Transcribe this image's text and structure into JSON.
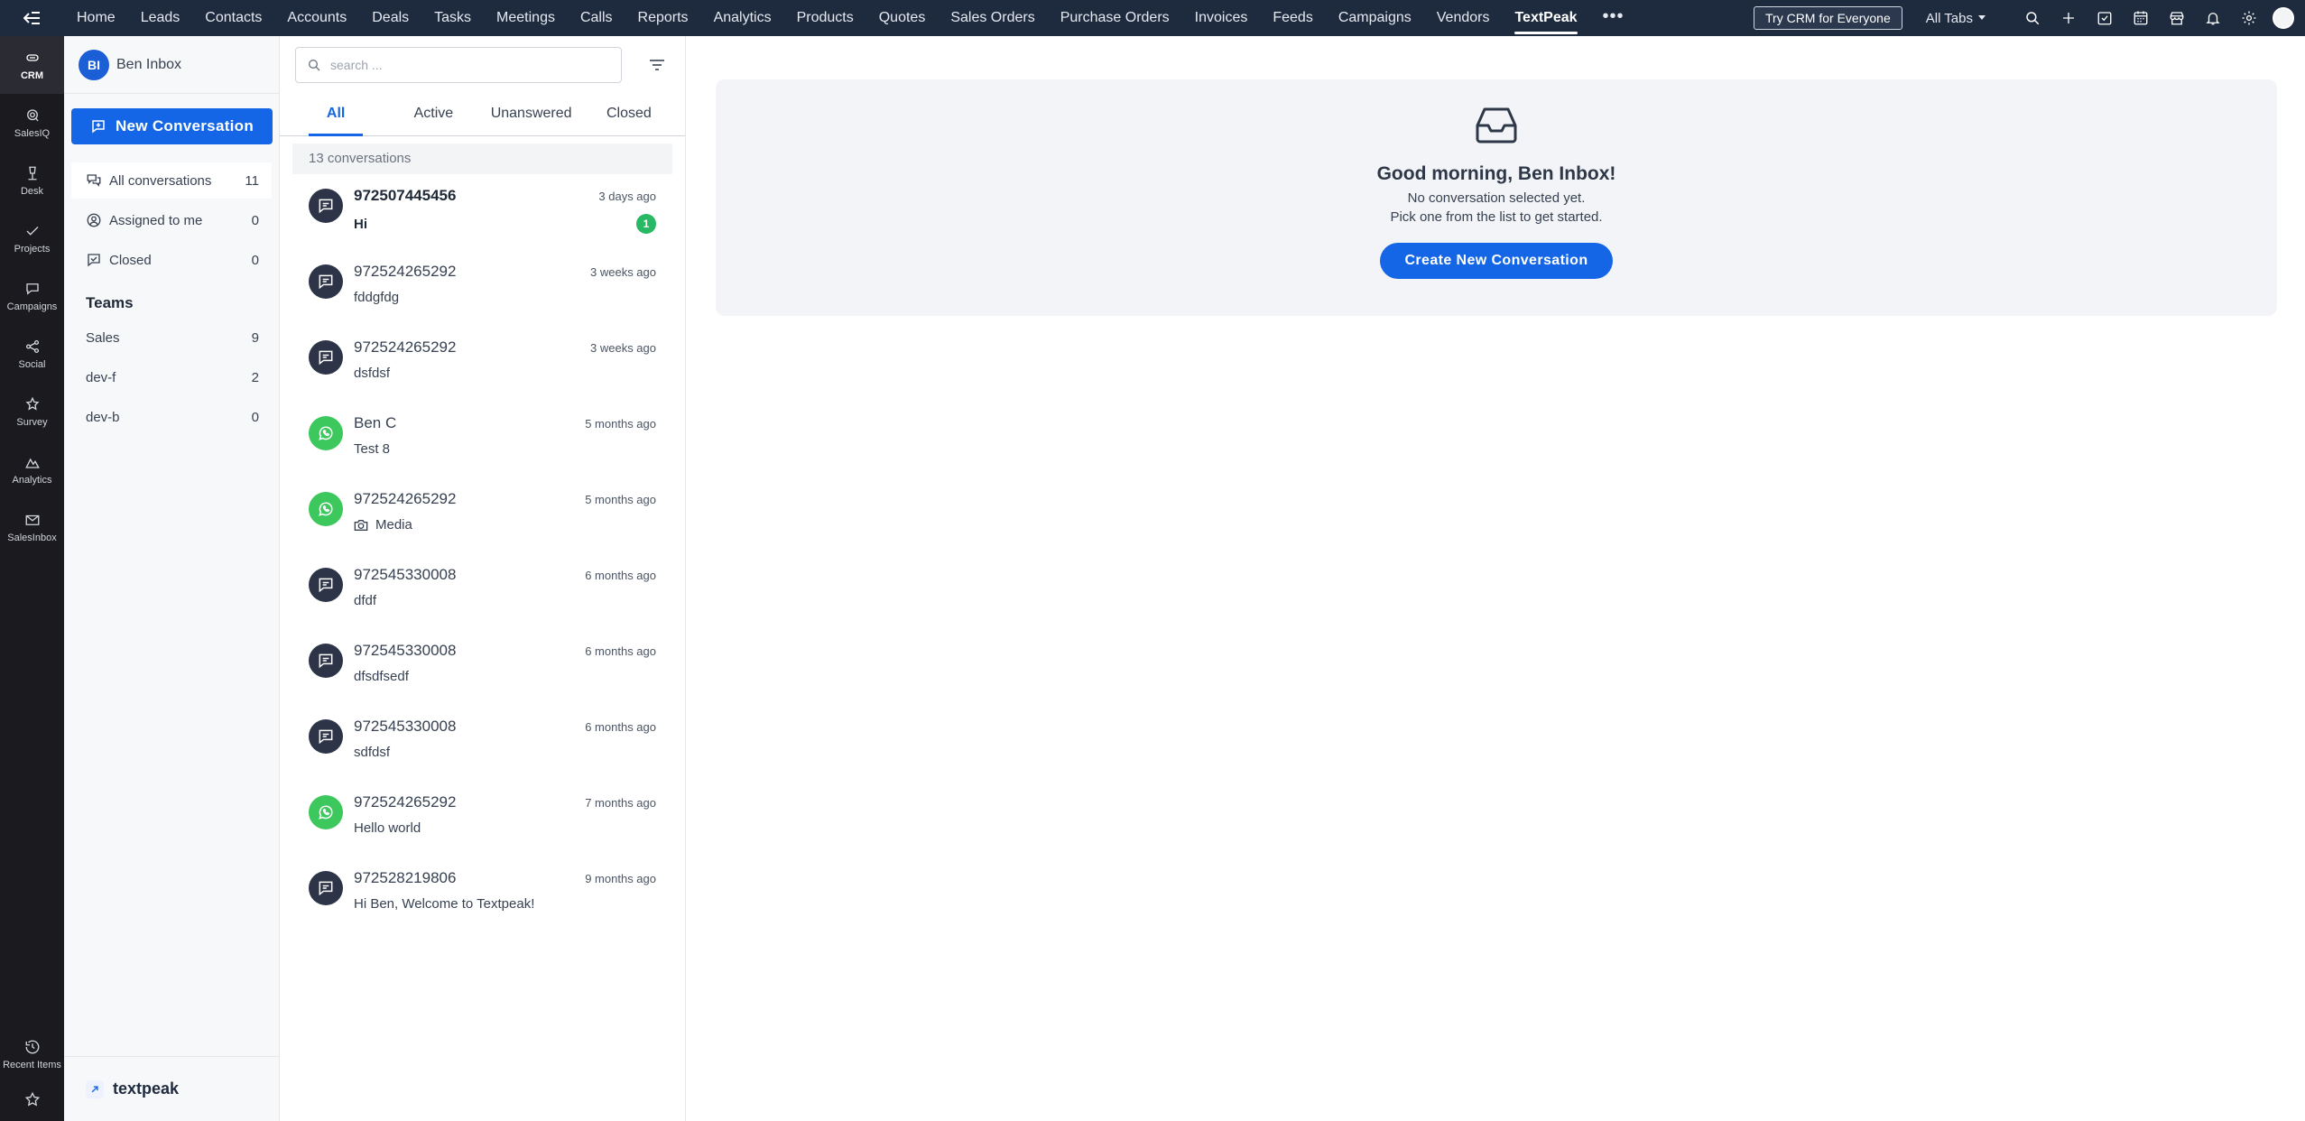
{
  "topnav": {
    "items": [
      "Home",
      "Leads",
      "Contacts",
      "Accounts",
      "Deals",
      "Tasks",
      "Meetings",
      "Calls",
      "Reports",
      "Analytics",
      "Products",
      "Quotes",
      "Sales Orders",
      "Purchase Orders",
      "Invoices",
      "Feeds",
      "Campaigns",
      "Vendors",
      "TextPeak"
    ],
    "active": "TextPeak",
    "more_label": "•••",
    "try_label": "Try CRM for Everyone",
    "alltabs_label": "All Tabs",
    "icons": [
      "search-icon",
      "plus-icon",
      "calendar-check-icon",
      "calendar-icon",
      "marketplace-icon",
      "bell-icon",
      "gear-icon",
      "user-avatar"
    ]
  },
  "rail": {
    "items": [
      {
        "label": "CRM",
        "icon": "crm-icon",
        "active": true
      },
      {
        "label": "SalesIQ",
        "icon": "salesiq-icon"
      },
      {
        "label": "Desk",
        "icon": "desk-icon"
      },
      {
        "label": "Projects",
        "icon": "projects-icon"
      },
      {
        "label": "Campaigns",
        "icon": "campaigns-icon"
      },
      {
        "label": "Social",
        "icon": "social-icon"
      },
      {
        "label": "Survey",
        "icon": "survey-icon"
      },
      {
        "label": "Analytics",
        "icon": "analytics-icon"
      },
      {
        "label": "SalesInbox",
        "icon": "salesinbox-icon"
      }
    ],
    "recent_label": "Recent Items"
  },
  "sidebar": {
    "avatar_initials": "BI",
    "user_name": "Ben Inbox",
    "new_conversation_label": "New Conversation",
    "items": [
      {
        "label": "All conversations",
        "count": "11",
        "icon": "chat-bubbles-icon"
      },
      {
        "label": "Assigned to me",
        "count": "0",
        "icon": "user-circle-icon"
      },
      {
        "label": "Closed",
        "count": "0",
        "icon": "closed-chat-icon"
      }
    ],
    "teams_title": "Teams",
    "teams": [
      {
        "label": "Sales",
        "count": "9"
      },
      {
        "label": "dev-f",
        "count": "2"
      },
      {
        "label": "dev-b",
        "count": "0"
      }
    ],
    "brand": "textpeak"
  },
  "list": {
    "search_placeholder": "search ...",
    "tabs": [
      "All",
      "Active",
      "Unanswered",
      "Closed"
    ],
    "count_label": "13 conversations",
    "conversations": [
      {
        "name": "972507445456",
        "time": "3 days ago",
        "message": "Hi",
        "channel": "sms",
        "unread": "1"
      },
      {
        "name": "972524265292",
        "time": "3 weeks ago",
        "message": "fddgfdg",
        "channel": "sms"
      },
      {
        "name": "972524265292",
        "time": "3 weeks ago",
        "message": "dsfdsf",
        "channel": "sms"
      },
      {
        "name": "Ben C",
        "time": "5 months ago",
        "message": "Test 8",
        "channel": "whatsapp"
      },
      {
        "name": "972524265292",
        "time": "5 months ago",
        "message": "Media",
        "channel": "whatsapp",
        "media": true
      },
      {
        "name": "972545330008",
        "time": "6 months ago",
        "message": "dfdf",
        "channel": "sms"
      },
      {
        "name": "972545330008",
        "time": "6 months ago",
        "message": "dfsdfsedf",
        "channel": "sms"
      },
      {
        "name": "972545330008",
        "time": "6 months ago",
        "message": "sdfdsf",
        "channel": "sms"
      },
      {
        "name": "972524265292",
        "time": "7 months ago",
        "message": "Hello world",
        "channel": "whatsapp"
      },
      {
        "name": "972528219806",
        "time": "9 months ago",
        "message": "Hi Ben, Welcome to Textpeak!",
        "channel": "sms"
      }
    ]
  },
  "main": {
    "greeting": "Good morning, Ben Inbox!",
    "line1": "No conversation selected yet.",
    "line2": "Pick one from the list to get started.",
    "create_label": "Create New Conversation"
  }
}
